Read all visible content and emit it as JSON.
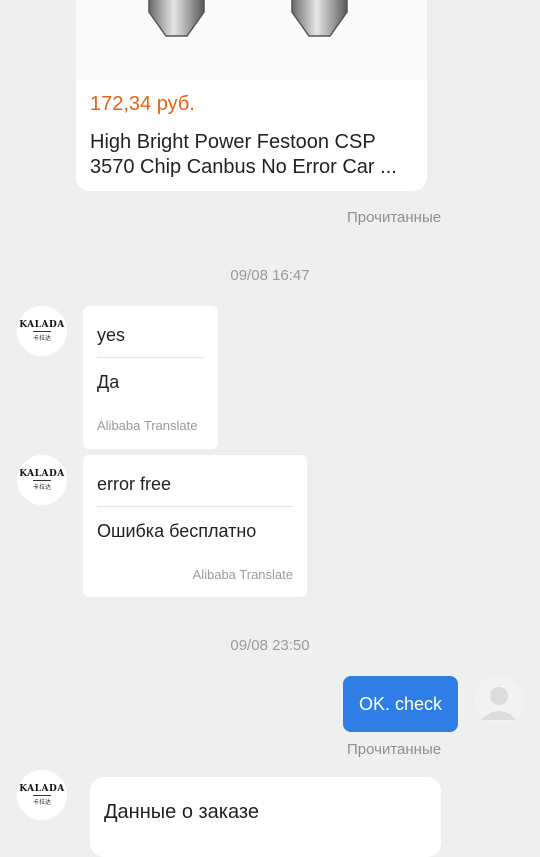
{
  "product": {
    "price": "172,34 руб.",
    "title": "High Bright Power Festoon CSP 3570 Chip Canbus No Error Car ..."
  },
  "read_status_1": "Прочитанные",
  "timestamp_1": "09/08 16:47",
  "seller_avatar": {
    "brand": "KALADA",
    "sub": "卡拉达"
  },
  "messages": [
    {
      "original": "yes",
      "translated": "Да",
      "credit": "Alibaba Translate"
    },
    {
      "original": "error free",
      "translated": "Ошибка бесплатно",
      "credit": "Alibaba Translate"
    }
  ],
  "timestamp_2": "09/08 23:50",
  "sent_message": "OK. check",
  "read_status_2": "Прочитанные",
  "order_card": {
    "title": "Данные о заказе"
  },
  "colors": {
    "background": "#efefef",
    "price": "#e8620e",
    "sent_bubble": "#2f7ee6"
  }
}
